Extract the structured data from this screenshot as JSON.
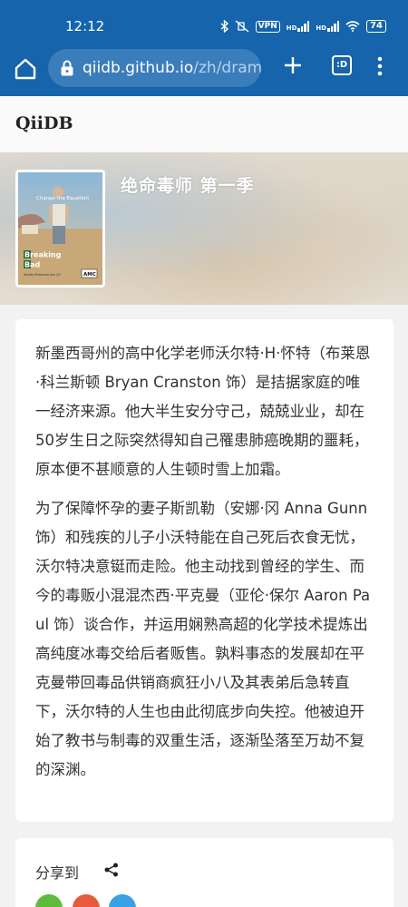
{
  "status_bar": {
    "time": "12:12",
    "vpn": "VPN",
    "network_1": "HD",
    "network_2": "HD",
    "battery": "74",
    "icons": [
      "bluetooth-icon",
      "mute-icon",
      "vpn-icon",
      "signal-icon",
      "signal-icon",
      "wifi-icon",
      "battery-icon"
    ]
  },
  "browser": {
    "url_domain": "qiidb.github.io",
    "url_path": "/zh/dram",
    "tabs_label": ":D",
    "icons": [
      "home-icon",
      "lock-icon",
      "plus-icon",
      "tabs-icon",
      "menu-icon"
    ]
  },
  "site": {
    "logo": "QiiDB"
  },
  "hero": {
    "title": "绝命毒师 第一季",
    "poster_tagline": "Change the Equation",
    "poster_title_1": "Breaking",
    "poster_title_2": "Bad",
    "poster_premiere": "Series Premiere Jan 20",
    "poster_network": "AMC"
  },
  "synopsis": {
    "paragraphs": [
      "新墨西哥州的高中化学老师沃尔特·H·怀特（布莱恩·科兰斯顿 Bryan Cranston 饰）是拮据家庭的唯一经济来源。他大半生安分守己，兢兢业业，却在50岁生日之际突然得知自己罹患肺癌晚期的噩耗，原本便不甚顺意的人生顿时雪上加霜。",
      "为了保障怀孕的妻子斯凯勒（安娜·冈 Anna Gunn 饰）和残疾的儿子小沃特能在自己死后衣食无忧，沃尔特决意铤而走险。他主动找到曾经的学生、而今的毒贩小混混杰西·平克曼（亚伦·保尔 Aaron Paul 饰）谈合作，并运用娴熟高超的化学技术提炼出高纯度冰毒交给后者贩售。孰料事态的发展却在平克曼带回毒品供销商疯狂小八及其表弟后急转直下，沃尔特的人生也由此彻底步向失控。他被迫开始了教书与制毒的双重生活，逐渐坠落至万劫不复的深渊。"
    ]
  },
  "share": {
    "label": "分享到",
    "buttons": [
      "wechat",
      "weibo",
      "twitter"
    ]
  },
  "colors": {
    "browser_bar": "#1564ac",
    "url_pill": "#3a7dbb",
    "page_bg": "#f2f2f2"
  }
}
